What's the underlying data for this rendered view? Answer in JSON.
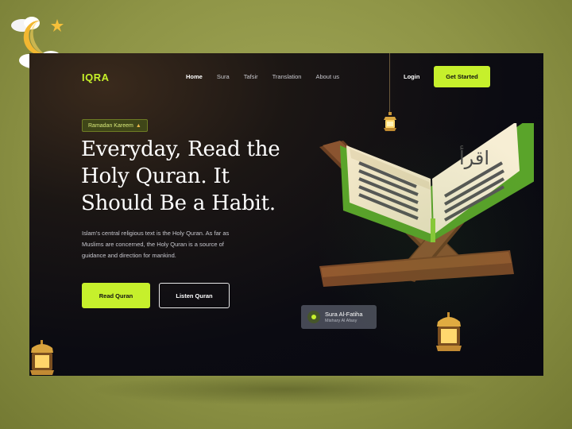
{
  "nav": {
    "logo": "IQRA",
    "links": [
      "Home",
      "Sura",
      "Tafsir",
      "Translation",
      "About us"
    ],
    "login": "Login",
    "cta": "Get Started"
  },
  "hero": {
    "badge": "Ramadan Kareem",
    "badge_icon": "mosque-icon",
    "headline_lines": [
      "Everyday, Read the",
      "Holy Quran. It",
      "Should Be a Habit."
    ],
    "desc_lines": [
      "Islam's central religious text is the Holy Quran. As far as",
      "Muslims are concerned, the Holy Quran is a source of",
      "guidance and direction for mankind."
    ],
    "read_button": "Read Quran",
    "listen_button": "Listen Quran"
  },
  "player": {
    "title": "Sura Al-Fatiha",
    "reciter": "Mishary Al Afasy"
  },
  "book": {
    "calligraphy": "اقرأ"
  },
  "colors": {
    "accent": "#c6f02c",
    "background": "#8e9446",
    "panel": "#0b0b12"
  }
}
